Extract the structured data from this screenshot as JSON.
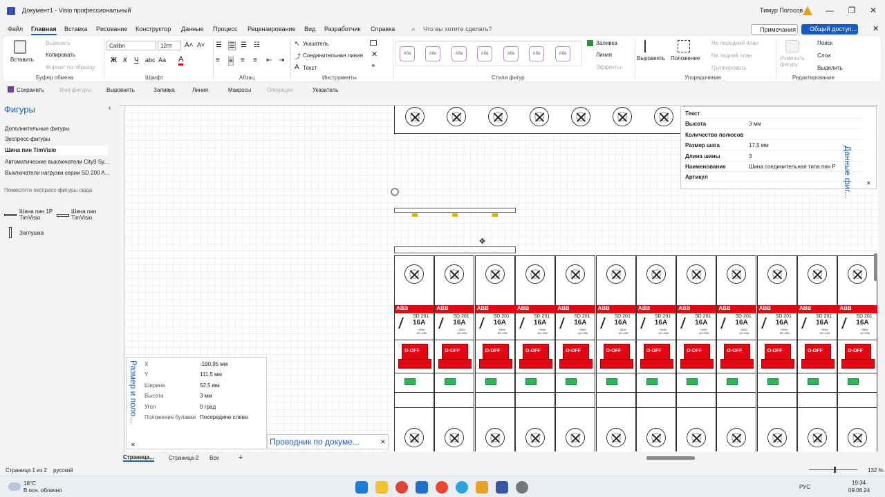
{
  "title_bar": {
    "doc_title": "Документ1 - Visio профессиональный",
    "user": "Тимур Погосов"
  },
  "menu": {
    "tabs": [
      "Файл",
      "Главная",
      "Вставка",
      "Рисование",
      "Конструктор",
      "Данные",
      "Процесс",
      "Рецензирование",
      "Вид",
      "Разработчик",
      "Справка"
    ],
    "search_placeholder": "Что вы хотите сделать?",
    "comments_label": "Примечания",
    "share_label": "Общий доступ..."
  },
  "ribbon": {
    "clipboard": {
      "paste": "Вставить",
      "cut": "Вырезать",
      "copy": "Копировать",
      "format_painter": "Формат по образцу",
      "label": "Буфер обмена"
    },
    "font": {
      "name": "Calibri",
      "size": "12пт",
      "label": "Шрифт"
    },
    "paragraph": {
      "label": "Абзац"
    },
    "tools": {
      "pointer": "Указатель",
      "connector": "Соединительная линия",
      "text": "Текст",
      "label": "Инструменты"
    },
    "styles": {
      "sample": "Абв",
      "label": "Стили фигур",
      "fill": "Заливка",
      "line": "Линия",
      "effects": "Эффекты"
    },
    "arrange": {
      "align": "Выровнять",
      "position": "Положение",
      "bring_front": "На передний план",
      "send_back": "На задний план",
      "group": "Группировать",
      "label": "Упорядочение"
    },
    "editing": {
      "change_shape": "Изменить фигуру",
      "find": "Поиск",
      "layers": "Слои",
      "select": "Выделить",
      "label": "Редактирование"
    }
  },
  "qat": {
    "save": "Сохранить",
    "shape_name": "Имя фигуры",
    "align": "Выровнять",
    "fill": "Заливка",
    "line": "Линия",
    "macros": "Макросы",
    "operations": "Операции",
    "pointer": "Указатель"
  },
  "shapes_panel": {
    "title": "Фигуры",
    "more_shapes": "Дополнительные фигуры",
    "quick_shapes": "Экспресс-фигуры",
    "stencils": [
      "Шина пин TimVisio",
      "Автоматические выключатели City9 Sy...",
      "Выключатели нагрузки серии SD 200 A..."
    ],
    "drop_hint": "Поместите экспресс-фигуры сюда",
    "items": [
      {
        "label": "Шина пин 1P TimVisio"
      },
      {
        "label": "Шина пин TimVisio"
      },
      {
        "label": "Заглушка"
      }
    ]
  },
  "breaker": {
    "brand": "ABB",
    "model": "SD 201",
    "rating": "16A",
    "voltage": "~253V",
    "category": "AC-23A",
    "state": "O-OFF",
    "count": 12
  },
  "shape_data": {
    "title": "Данные фиг...",
    "rows": [
      {
        "k": "Текст",
        "v": ""
      },
      {
        "k": "Высота",
        "v": "3 мм"
      },
      {
        "k": "Количество полюсов",
        "v": ""
      },
      {
        "k": "Размер шага",
        "v": "17,5 мм"
      },
      {
        "k": "Длина шины",
        "v": "3"
      },
      {
        "k": "Наименование",
        "v": "Шина соединительная типа пин Р"
      },
      {
        "k": "Артикул",
        "v": ""
      }
    ]
  },
  "size_pos": {
    "title": "Размер и поло...",
    "rows": [
      {
        "k": "X",
        "v": "-190,95 мм"
      },
      {
        "k": "Y",
        "v": "111,5 мм"
      },
      {
        "k": "Ширина",
        "v": "52,5 мм"
      },
      {
        "k": "Высота",
        "v": "3 мм"
      },
      {
        "k": "Угол",
        "v": "0 град"
      },
      {
        "k": "Положение булавки",
        "v": "Посередине слева"
      }
    ]
  },
  "navigator": {
    "title": "Проводник по докуме..."
  },
  "page_tabs": {
    "tabs": [
      "Страница...",
      "Страница-2",
      "Все"
    ]
  },
  "status": {
    "page": "Страница 1 из 2",
    "language": "русский",
    "zoom": "132 %"
  },
  "taskbar": {
    "weather_temp": "18°C",
    "weather_desc": "В осн. облачно",
    "lang": "РУС",
    "time": "19:34",
    "date": "09.06.24"
  }
}
